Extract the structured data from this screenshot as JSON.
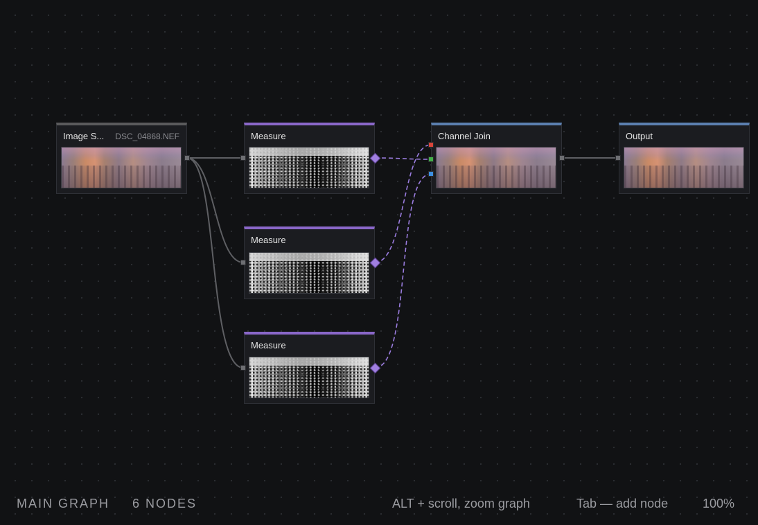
{
  "graph": {
    "name": "MAIN GRAPH",
    "node_count": "6 NODES"
  },
  "nodes": {
    "image_source": {
      "title": "Image S...",
      "file": "DSC_04868.NEF"
    },
    "measure_1": {
      "title": "Measure"
    },
    "measure_2": {
      "title": "Measure"
    },
    "measure_3": {
      "title": "Measure"
    },
    "channel_join": {
      "title": "Channel Join"
    },
    "output": {
      "title": "Output"
    }
  },
  "hints": {
    "zoom": "ALT + scroll, zoom graph",
    "add": "Tab — add node",
    "zoom_level": "100%"
  },
  "colors": {
    "background": "#111214",
    "measure_accent": "#8a67c9",
    "channel_accent": "#5b7fb0",
    "port_red": "#d9453a",
    "port_green": "#43b04a",
    "port_blue": "#3d8fe0"
  }
}
